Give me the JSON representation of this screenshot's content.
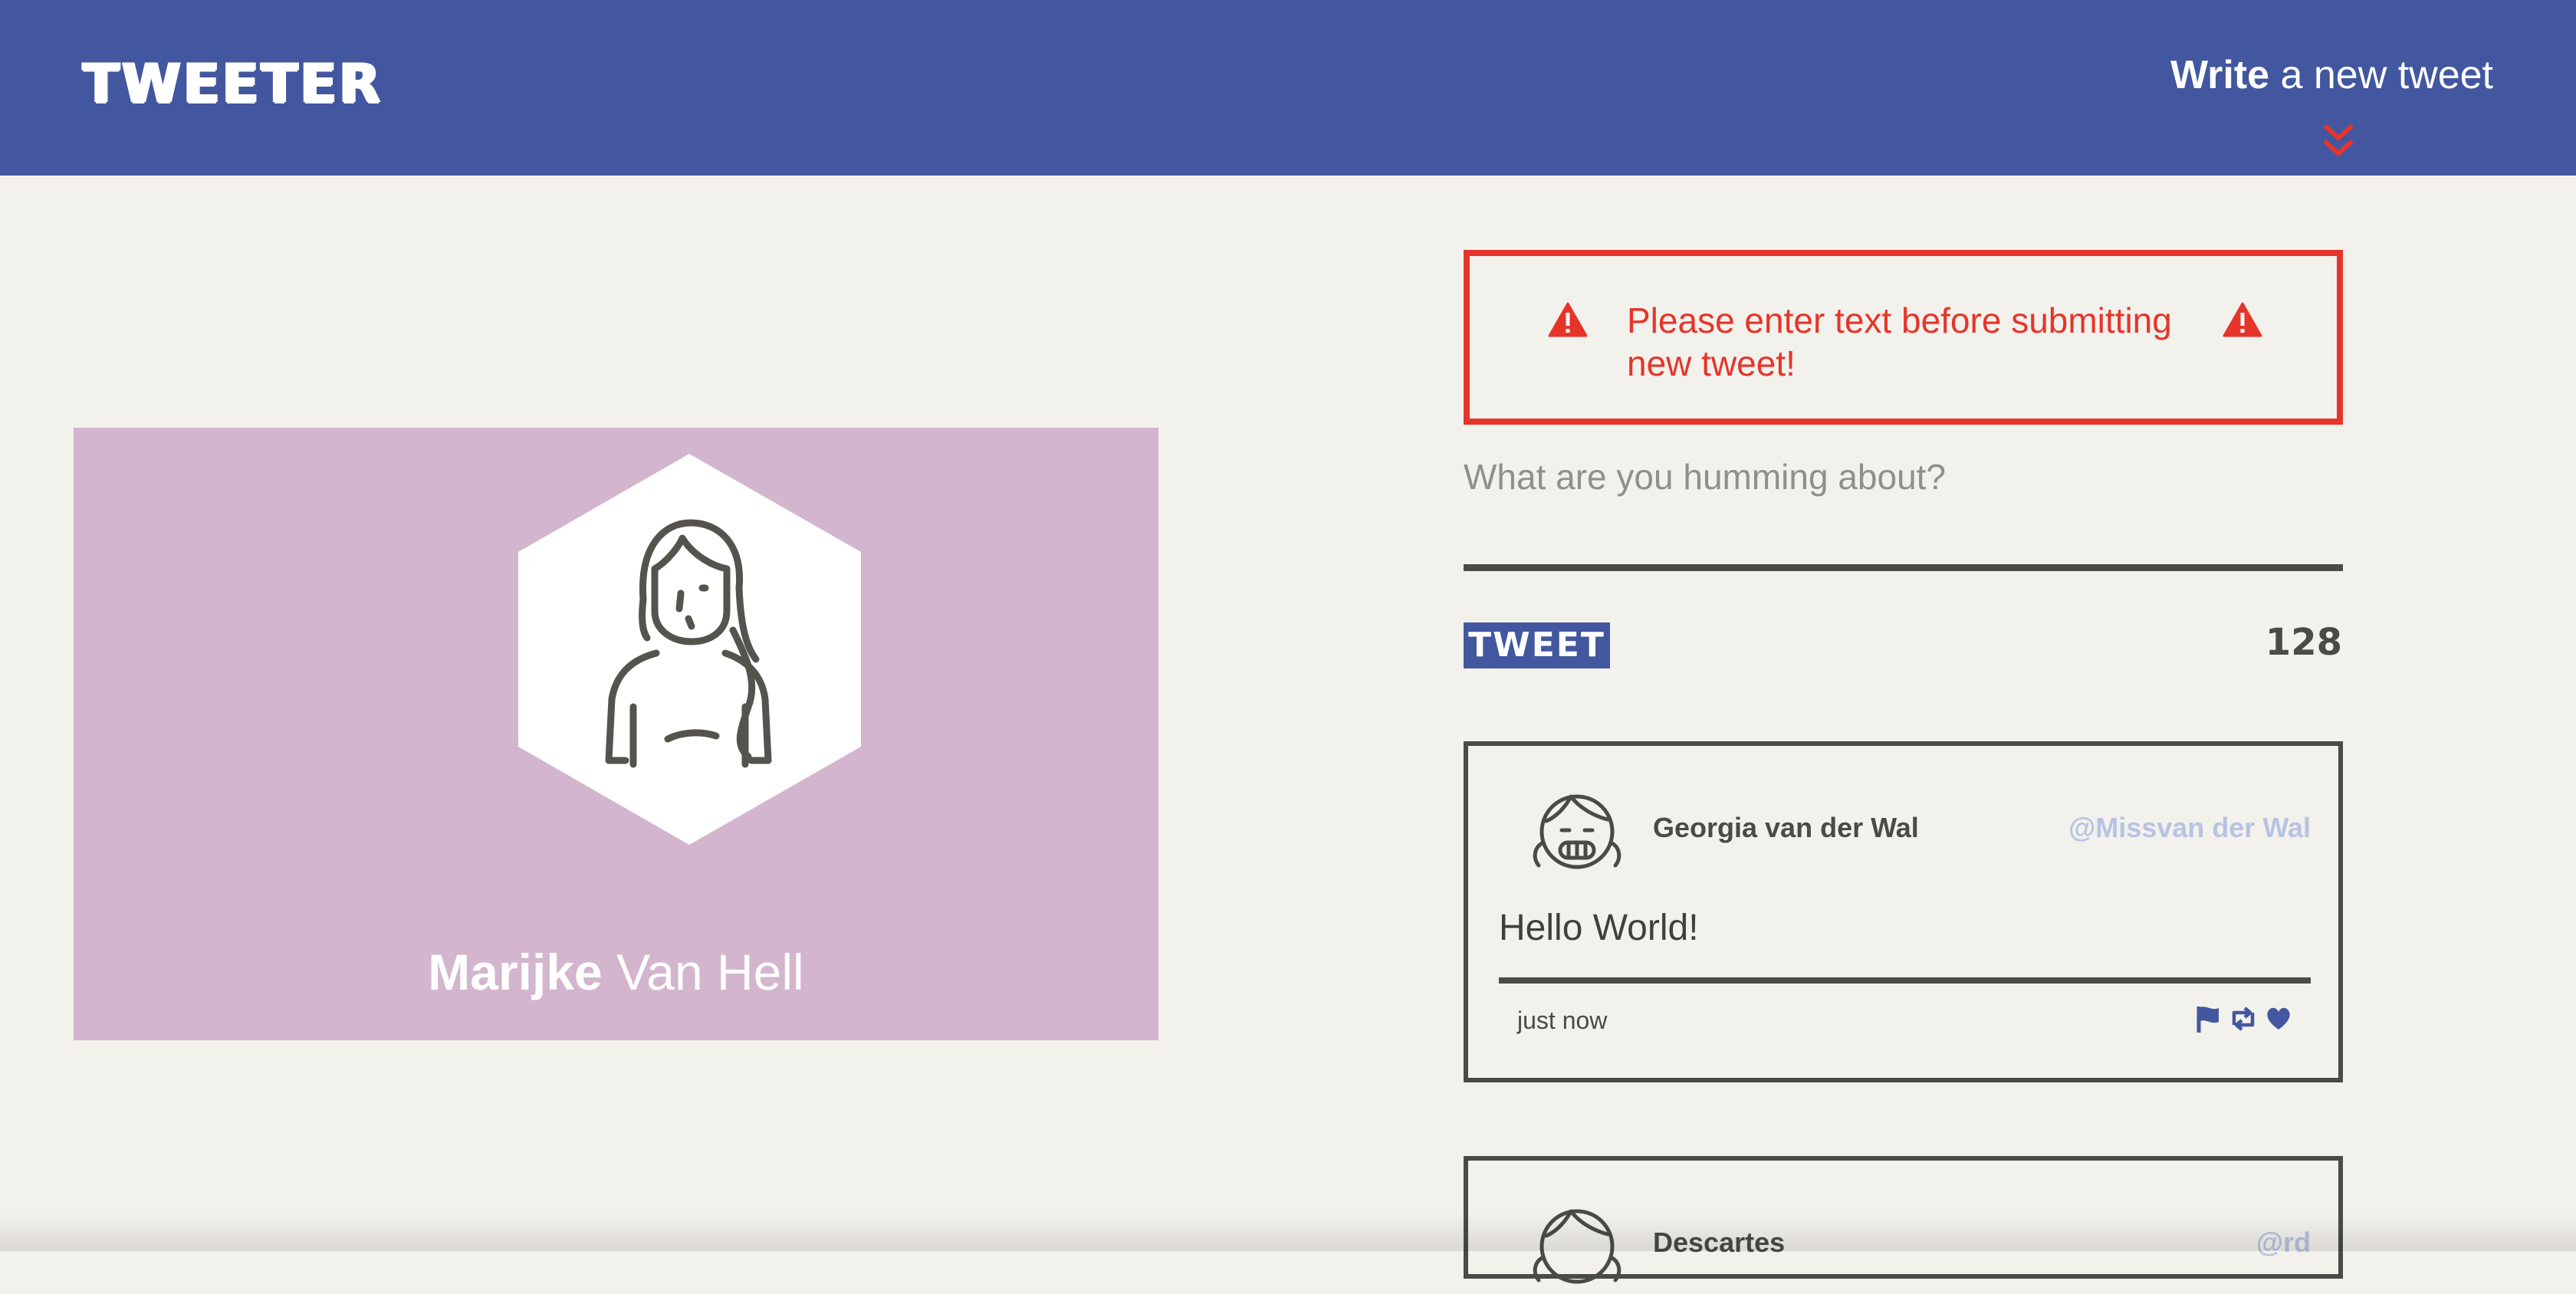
{
  "nav": {
    "logo": "TWEETER",
    "compose_strong": "Write",
    "compose_rest": " a new tweet",
    "arrow_icon": "double-chevron-down-icon"
  },
  "profile": {
    "first_name": "Marijke",
    "last_name": "Van Hell",
    "background_color": "#d3b5ce",
    "avatar_icon": "woman-avatar-icon"
  },
  "compose": {
    "error_message": "Please enter text before submitting new tweet!",
    "warning_icon": "warning-triangle-icon",
    "placeholder": "What are you humming about?",
    "value": "",
    "button_label": "TWEET",
    "char_counter": "128"
  },
  "tweets": [
    {
      "name": "Georgia van der Wal",
      "handle": "@Missvan der Wal",
      "content": "Hello World!",
      "time": "just now",
      "avatar_icon": "girl-avatar-icon",
      "actions": [
        "flag-icon",
        "retweet-icon",
        "heart-icon"
      ]
    },
    {
      "name": "Descartes",
      "handle": "@rd",
      "avatar_icon": "girl-avatar-icon"
    }
  ],
  "colors": {
    "nav": "#42579f",
    "page": "#f3f1ec",
    "error": "#e5352a",
    "text_dark": "#4a4a46",
    "handle": "#b7c3e1"
  }
}
